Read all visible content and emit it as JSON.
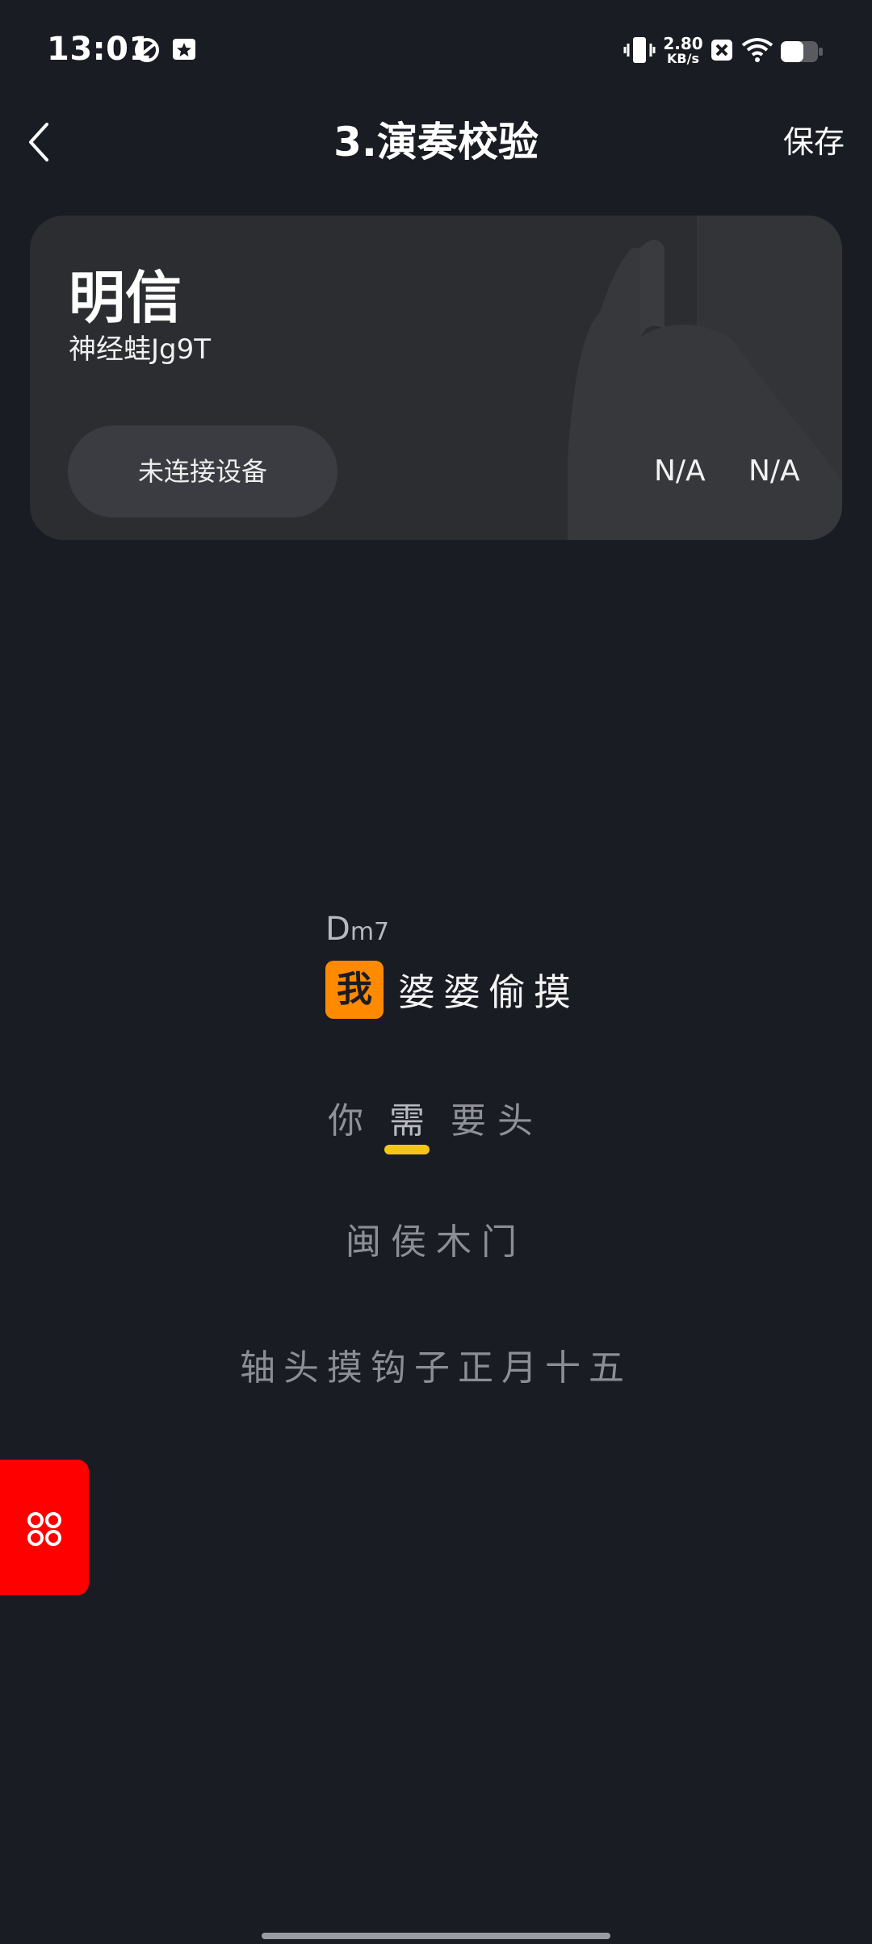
{
  "status_bar": {
    "time": "13:01",
    "net_speed_value": "2.80",
    "net_speed_unit": "KB/s",
    "icons": [
      "leaf-icon",
      "star-notification-icon",
      "vibrate-icon",
      "sim-x-icon",
      "wifi-icon",
      "battery-icon"
    ]
  },
  "header": {
    "title": "3.演奏校验",
    "save_label": "保存",
    "back_icon": "chevron-left-icon"
  },
  "song_card": {
    "title": "明信",
    "artist": "神经蛙Jg9T",
    "device_status": "未连接设备",
    "stat_1": "N/A",
    "stat_2": "N/A"
  },
  "lyrics": {
    "chord_root": "D",
    "chord_quality": "m7",
    "current_char": "我",
    "current_rest": "婆婆偷摸",
    "line2_before": "你",
    "line2_active": "需",
    "line2_after": "要头",
    "line3": "闽侯木门",
    "line4": "轴头摸钩子正月十五"
  },
  "colors": {
    "background": "#1a1c23",
    "card": "#2c2d31",
    "highlight": "#ff8a00",
    "underline": "#f2c71a",
    "float_button": "#ff0000"
  }
}
